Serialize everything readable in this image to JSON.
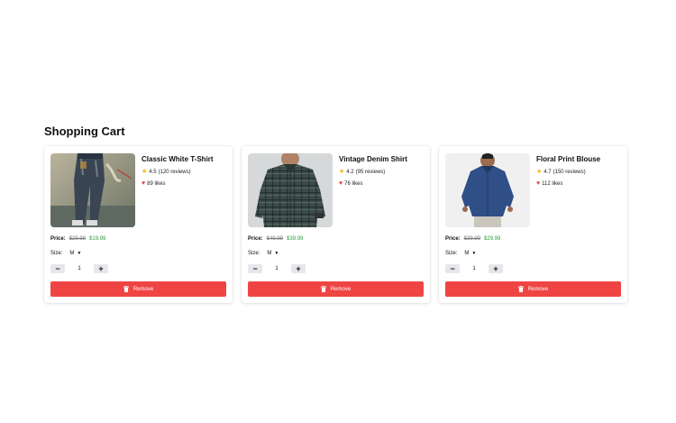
{
  "page": {
    "title": "Shopping Cart"
  },
  "labels": {
    "price": "Price:",
    "size": "Size:",
    "remove": "Remove",
    "minus": "−",
    "plus": "+"
  },
  "colors": {
    "remove_button": "#ef4444",
    "sale_price": "#2f9e44",
    "star": "#f5b400",
    "heart": "#e53e3e"
  },
  "icons": {
    "rating": "star-icon",
    "likes": "heart-icon",
    "remove": "trash-icon",
    "size_select": "chevron-down-icon"
  },
  "items": [
    {
      "name": "Classic White T-Shirt",
      "rating": "4.5",
      "reviews": "(120 reviews)",
      "likes": "89 likes",
      "old_price": "$29.99",
      "new_price": "$19.99",
      "size": "M",
      "quantity": "1"
    },
    {
      "name": "Vintage Denim Shirt",
      "rating": "4.2",
      "reviews": "(95 reviews)",
      "likes": "76 likes",
      "old_price": "$49.99",
      "new_price": "$39.99",
      "size": "M",
      "quantity": "1"
    },
    {
      "name": "Floral Print Blouse",
      "rating": "4.7",
      "reviews": "(150 reviews)",
      "likes": "112 likes",
      "old_price": "$39.99",
      "new_price": "$29.99",
      "size": "M",
      "quantity": "1"
    }
  ]
}
